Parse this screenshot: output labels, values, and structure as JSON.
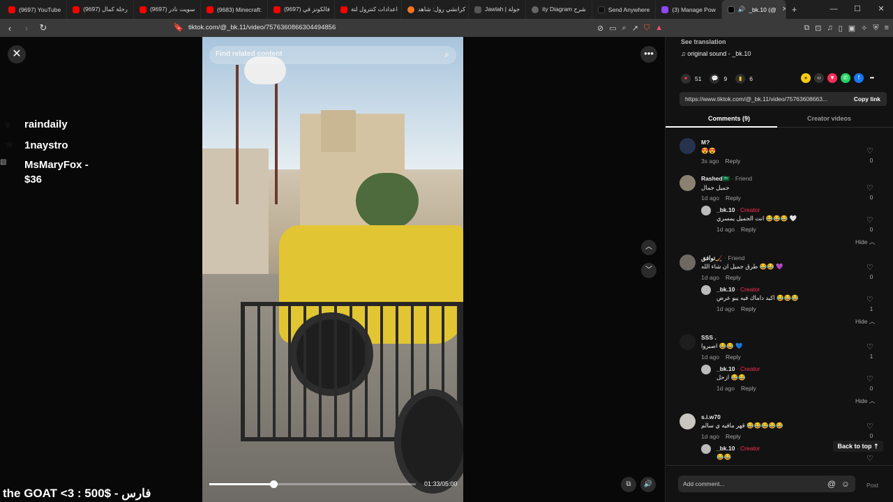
{
  "browser": {
    "tabs": [
      {
        "label": "(9697) YouTube",
        "color": "#ff0000"
      },
      {
        "label": "(9697) رحلة كمال",
        "color": "#ff0000"
      },
      {
        "label": "(9697) سويت نادر",
        "color": "#ff0000"
      },
      {
        "label": "(9683) Minecraft:",
        "color": "#ff0000"
      },
      {
        "label": "(9697) فالكونز في",
        "color": "#ff0000"
      },
      {
        "label": "اعدادات كنترول لتة",
        "color": "#ff0000"
      },
      {
        "label": "كرانشي رول: شاهد",
        "color": "#f47521"
      },
      {
        "label": "Jawlah | جولة",
        "color": "#333333"
      },
      {
        "label": "ity Diagram شرح",
        "color": "#555555"
      },
      {
        "label": "Send Anywhere",
        "color": "#111111"
      },
      {
        "label": "(3) Manage Pow",
        "color": "#9146ff"
      },
      {
        "label": "_bk.10 (@",
        "color": "#000000"
      }
    ],
    "url": "tiktok.com/@_bk.11/video/7576360866304494856",
    "new_tab": "+",
    "min": "—",
    "max": "☐",
    "close": "✕"
  },
  "stream": {
    "donors": [
      {
        "name": "raindaily",
        "icon": "heart-icon"
      },
      {
        "name": "1naystro",
        "icon": "star-icon"
      },
      {
        "name": "MsMaryFox -",
        "name2": "$36",
        "icon": "broken-image-icon"
      }
    ],
    "ticker": "the GOAT <3 : 500$ - فارس"
  },
  "video": {
    "search_placeholder": "Find related content",
    "current_time": "01:33",
    "total_time": "05:00",
    "time_display": "01:33/05:00",
    "progress": 0.31
  },
  "panel": {
    "see_translation": "See translation",
    "sound": "original sound - _bk.10",
    "likes": "51",
    "comments_count": "9",
    "saves": "6",
    "link": "https://www.tiktok.com/@_bk.11/video/75763608663...",
    "copy_link": "Copy link",
    "tab_comments": "Comments (9)",
    "tab_creator": "Creator videos",
    "back_to_top": "Back to top",
    "add_comment": "Add comment...",
    "post": "Post",
    "reply": "Reply",
    "hide": "Hide",
    "comments": [
      {
        "name": "M?",
        "text": "😍😍",
        "age": "3s ago",
        "likes": "0"
      },
      {
        "name": "Rashed🇸🇦",
        "tag": " · Friend",
        "text": "جميل جمال",
        "age": "1d ago",
        "likes": "0"
      },
      {
        "name": "_bk.10",
        "tag": " · Creator",
        "text": "انت الجميل يمسري 😂😂😂 🤍",
        "age": "1d ago",
        "likes": "0"
      },
      {
        "name": "توافق🏒",
        "tag": " · Friend",
        "text": "طرق جميل ان شاء الله 😂😂 💜",
        "age": "1d ago",
        "likes": "0"
      },
      {
        "name": "_bk.10",
        "tag": " · Creator",
        "text": "اكيد داماك فيه يبو عرض 😂😂😂",
        "age": "1d ago",
        "likes": "1"
      },
      {
        "name": "SSS .",
        "text": "اصبروا 😂😂 💙",
        "age": "1d ago",
        "likes": "1"
      },
      {
        "name": "_bk.10",
        "tag": " · Creator",
        "text": "ازحل 😂😂",
        "age": "1d ago",
        "likes": "0"
      },
      {
        "name": "s.i.w70",
        "text": "قهر مافيه ي سالم 😂😂😂😂😂",
        "age": "1d ago",
        "likes": "0"
      },
      {
        "name": "_bk.10",
        "tag": " · Creator",
        "text": "😂😂",
        "age": "",
        "likes": ""
      }
    ]
  }
}
